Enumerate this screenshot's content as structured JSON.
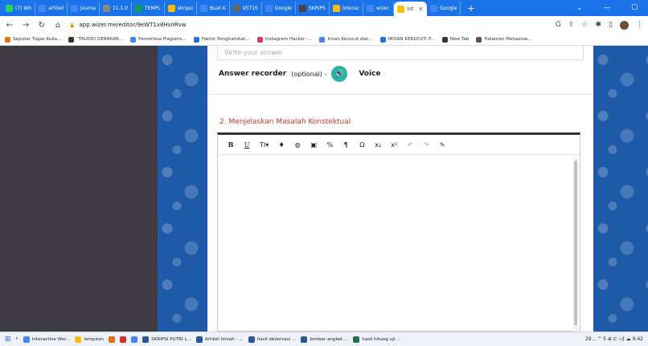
{
  "browser": {
    "tabs": [
      {
        "label": "(7) Wh",
        "color": "#25d366"
      },
      {
        "label": "artikel",
        "color": "#4285f4"
      },
      {
        "label": "journa",
        "color": "#4285f4"
      },
      {
        "label": "11.1.0",
        "color": "#888888"
      },
      {
        "label": "TEMPL",
        "color": "#0f9d58"
      },
      {
        "label": "skripsi",
        "color": "#fbbc04"
      },
      {
        "label": "Buat K",
        "color": "#4285f4"
      },
      {
        "label": "95T1S",
        "color": "#666666"
      },
      {
        "label": "Google",
        "color": "#4285f4"
      },
      {
        "label": "SKRIPS",
        "color": "#444444"
      },
      {
        "label": "Interac",
        "color": "#fbbc04"
      },
      {
        "label": "wizer.",
        "color": "#4285f4"
      },
      {
        "label": "Int",
        "color": "#fbbc04",
        "active": true
      },
      {
        "label": "Google",
        "color": "#4285f4"
      }
    ],
    "new_tab_label": "+",
    "url": "app.wizer.me/editor/9eWT1x8HsnRvw",
    "bookmarks": [
      {
        "label": "Seputar Tugas Kulia...",
        "color": "#e8710a"
      },
      {
        "label": "\"TAUDID GERAKAN...",
        "color": "#333333"
      },
      {
        "label": "Pemeriksa Plagiaris...",
        "color": "#4285f4"
      },
      {
        "label": "Faktor Penghambat...",
        "color": "#1a73e8"
      },
      {
        "label": "Instagram Hacker -...",
        "color": "#e1306c"
      },
      {
        "label": "Irisan Kerucut dan...",
        "color": "#4285f4"
      },
      {
        "label": "IRISAN KERUCUT: P...",
        "color": "#1a73e8"
      },
      {
        "label": "New Tab",
        "color": "#333333"
      },
      {
        "label": "Halaman Mahasisw...",
        "color": "#6b4f3a"
      }
    ]
  },
  "editor": {
    "answer_placeholder": "Write your answer",
    "recorder_label": "Answer recorder",
    "recorder_optional": "(optional) -",
    "voice_label": "Voice",
    "question_title": "2. Menjelaskan Masalah Konstektual",
    "toolbar": [
      "B",
      "U",
      "TI▾",
      "♦",
      "◍",
      "▣",
      "%",
      "¶",
      "Ω",
      "x₂",
      "x²",
      "↶",
      "↷",
      "✎"
    ]
  },
  "taskbar": {
    "items": [
      {
        "label": "Interactive Wor...",
        "color": "#4285f4"
      },
      {
        "label": "lampiran",
        "color": "#fbbc04"
      },
      {
        "label": "",
        "color": "#e8710a"
      },
      {
        "label": "",
        "color": "#d93025"
      },
      {
        "label": "",
        "color": "#4285f4"
      },
      {
        "label": "SKRIPSI PUTRI L...",
        "color": "#2b579a"
      },
      {
        "label": "Artikel Ilmiah - ...",
        "color": "#2b579a"
      },
      {
        "label": "hasil observasi ...",
        "color": "#2b579a"
      },
      {
        "label": "lembar angket ...",
        "color": "#2b579a"
      },
      {
        "label": "hasil hitung uji ...",
        "color": "#217346"
      }
    ],
    "tray_text": "29... ^ 5 ⊕ ⊏ ◁) ☁ 9:42"
  }
}
